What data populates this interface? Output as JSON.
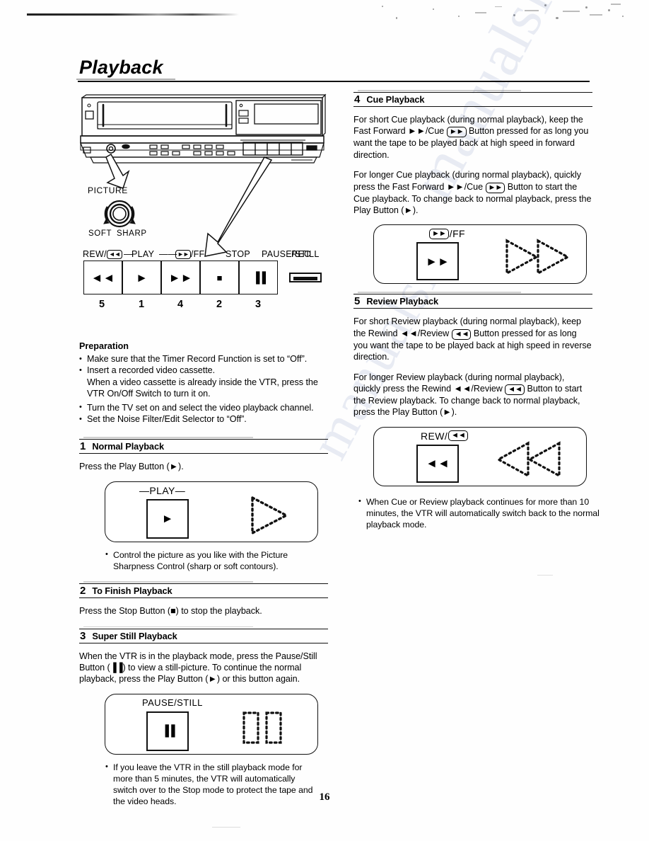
{
  "document": {
    "title": "Playback",
    "page_number": "16"
  },
  "diagram": {
    "picture_label": "PICTURE",
    "knob_left_label": "SOFT",
    "knob_right_label": "SHARP",
    "button_labels": {
      "rew": "REW/",
      "play": "PLAY",
      "ff": "/FF",
      "stop": "STOP",
      "pause_still": "PAUSE/STILL",
      "rec": "REC"
    },
    "button_numbers": [
      "5",
      "1",
      "4",
      "2",
      "3"
    ],
    "button_glyphs": {
      "rew": "◄◄",
      "play": "►",
      "ff": "►►",
      "stop": "■",
      "pause": "▐▐"
    }
  },
  "preparation": {
    "heading": "Preparation",
    "items": [
      "Make sure that the Timer Record Function is set to “Off”.",
      "Insert a recorded video cassette.",
      "Turn the TV set on and select the video playback channel.",
      "Set the Noise Filter/Edit Selector to “Off”."
    ],
    "sub_item": "When a video cassette is already inside the VTR, press the VTR On/Off Switch to turn it on."
  },
  "sections": {
    "normal_playback": {
      "num": "1",
      "label": "Normal Playback",
      "body": "Press the Play Button (►).",
      "illustration": {
        "caption": "—PLAY—",
        "key_glyph": "►"
      },
      "note": "Control the picture as you like with the Picture Sharpness Control (sharp or soft contours)."
    },
    "finish_playback": {
      "num": "2",
      "label": "To Finish Playback",
      "body": "Press the Stop Button (■) to stop the playback."
    },
    "super_still": {
      "num": "3",
      "label": "Super Still Playback",
      "body": "When the VTR is in the playback mode, press the Pause/Still Button (▐▐) to view a still-picture. To continue the normal playback, press the Play Button (►) or this button again.",
      "illustration": {
        "caption": "PAUSE/STILL",
        "key_glyph": "▐▐"
      },
      "note": "If you leave the VTR in the still playback mode for more than 5 minutes, the VTR will automatically switch over to the Stop mode to protect the tape and the video heads."
    },
    "cue_playback": {
      "num": "4",
      "label": "Cue Playback",
      "body1_a": "For short Cue playback (during normal playback), keep the Fast Forward ►►/Cue ",
      "body1_b": " Button pressed for as long you want the tape to be played back at high speed in forward direction.",
      "body2_a": "For longer Cue playback (during normal playback), quickly press the Fast Forward ►►/Cue ",
      "body2_b": " Button to start the Cue playback. To change back to normal playback, press the Play Button (►).",
      "illustration": {
        "caption_suffix": "/FF",
        "caption_badge": "►►",
        "key_glyph": "►►"
      }
    },
    "review_playback": {
      "num": "5",
      "label": "Review Playback",
      "body1_a": "For short Review playback (during normal playback), keep the Rewind ◄◄/Review ",
      "body1_b": " Button pressed for as long you want the tape to be played back at high speed in reverse direction.",
      "body2_a": "For longer Review playback (during normal playback), quickly press the Rewind ◄◄/Review ",
      "body2_b": " Button to start the Review playback. To change back to normal playback, press the Play Button (►).",
      "illustration": {
        "caption_prefix": "REW/",
        "caption_badge": "◄◄",
        "key_glyph": "◄◄"
      },
      "note": "When Cue or Review playback continues for more than 10 minutes, the VTR will automatically switch back to the normal playback mode."
    }
  },
  "watermark": {
    "text": "manualsli"
  }
}
